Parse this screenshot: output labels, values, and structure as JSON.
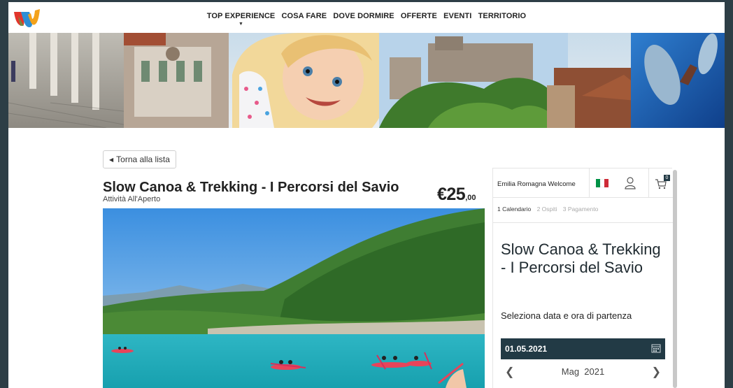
{
  "nav": {
    "items": [
      "TOP EXPERIENCE",
      "COSA FARE",
      "DOVE DORMIRE",
      "OFFERTE",
      "EVENTI",
      "TERRITORIO"
    ]
  },
  "back": {
    "label": "Torna alla lista"
  },
  "product": {
    "title": "Slow Canoa & Trekking - I Percorsi del Savio",
    "category": "Attività All'Aperto",
    "price_main": "€25",
    "price_cents": ",00"
  },
  "widget": {
    "brand": "Emilia Romagna Welcome",
    "cart_count": "0",
    "steps": [
      "1  Calendario",
      "2  Ospiti",
      "3  Pagamento"
    ],
    "title": "Slow Canoa & Trekking - I Percorsi del Savio",
    "select_label": "Seleziona data e ora di partenza",
    "date": "01.05.2021",
    "month": "Mag",
    "year": "2021"
  },
  "colors": {
    "outer_bg": "#2d3e46",
    "date_bar": "#223a45",
    "flag_green": "#009246",
    "flag_white": "#ffffff",
    "flag_red": "#ce2b37"
  },
  "icons": [
    "logo-icon",
    "user-icon",
    "cart-icon",
    "calendar-icon",
    "chevron-left-icon",
    "chevron-right-icon",
    "chevron-down-icon"
  ]
}
